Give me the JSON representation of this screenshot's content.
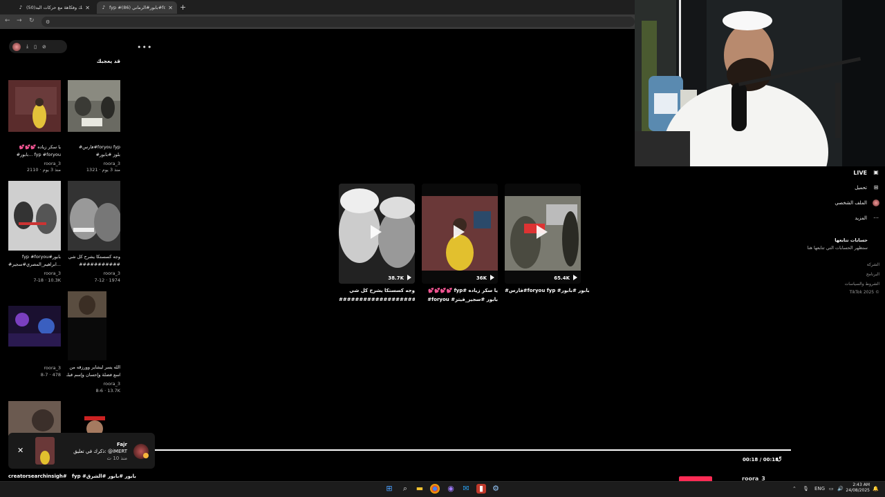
{
  "browser": {
    "tabs": [
      {
        "label": "(50)ضحك وفكاهة مع حركات البد"
      },
      {
        "label": "fyp #بابور#الرماني (86)#foryou"
      }
    ],
    "url_host": "tiktok.com",
    "url_path": "/@roora_3/video/7541877416294223112"
  },
  "sidebar_title": "قد يعجبك",
  "grid": [
    {
      "caption1": "#فارس#foryou fyp",
      "caption2": "#بلوز #بابور",
      "author": "roora_3",
      "meta": "1321 · منذ 3 يوم"
    },
    {
      "caption1": "💕💕💕 يا سكر زياده",
      "caption2": "#بابور... fyp #foryou",
      "author": "roora_3",
      "meta": "2110 · منذ 3 يوم"
    },
    {
      "caption1": "وجه كسستكا يشرح كل شي",
      "caption2": "###########",
      "author": "roora_3",
      "meta": "7-12 · 1974"
    },
    {
      "caption1": "fyp #foryou#بابور",
      "caption2": "#ابراهيم_المصري#سجير...",
      "author": "roora_3",
      "meta": "7-18 · 10.3K"
    },
    {
      "caption1": "الله يسر ليشاير وورزقه من",
      "caption2": "واسع فضلة وإحسان وإسم قبلـ...",
      "author": "roora_3",
      "meta": "8-6 · 13.7K"
    },
    {
      "caption1": "",
      "caption2": "",
      "author": "roora_3",
      "meta": "8-7 · 478"
    }
  ],
  "videos": [
    {
      "count": "38.7K",
      "caption1": "وجه كسستكا يشرح كل شي",
      "caption2": "###########################"
    },
    {
      "count": "36K",
      "caption1": "💕💕💕💕 fyp# يا سكر زياده",
      "caption2": "#foryou #بابور #سجير_فيتز"
    },
    {
      "count": "65.4K",
      "caption1": "#فارس#foryou fyp #بابور #بابور",
      "caption2": ""
    }
  ],
  "right_nav": [
    {
      "label": "LIVE",
      "icon": "live-icon"
    },
    {
      "label": "تحميل",
      "icon": "upload-icon"
    },
    {
      "label": "الملف الشخصي",
      "icon": "profile-avatar"
    },
    {
      "label": "المزيد",
      "icon": "more-icon"
    }
  ],
  "following": {
    "title": "حسابات تتابعها",
    "subtitle": "ستظهر الحسابات التي تتابعها هنا"
  },
  "footer": [
    "الشركة",
    "البرنامج",
    "الشروط والسياسات",
    "TikTok 2025 ©"
  ],
  "player": {
    "time": "00:18 / 00:18",
    "author": "roora_3"
  },
  "notification": {
    "name": "Fajr",
    "text": "ذكرك في تعليق: @iMERT",
    "time": "منذ 10 ث"
  },
  "bottom_captions": [
    "creatorsearchinsigh#",
    "fyp #بابور #بابور #الشرق"
  ],
  "tray": {
    "lang": "ENG",
    "time": "2:43 AM",
    "date": "24/08/2025"
  }
}
